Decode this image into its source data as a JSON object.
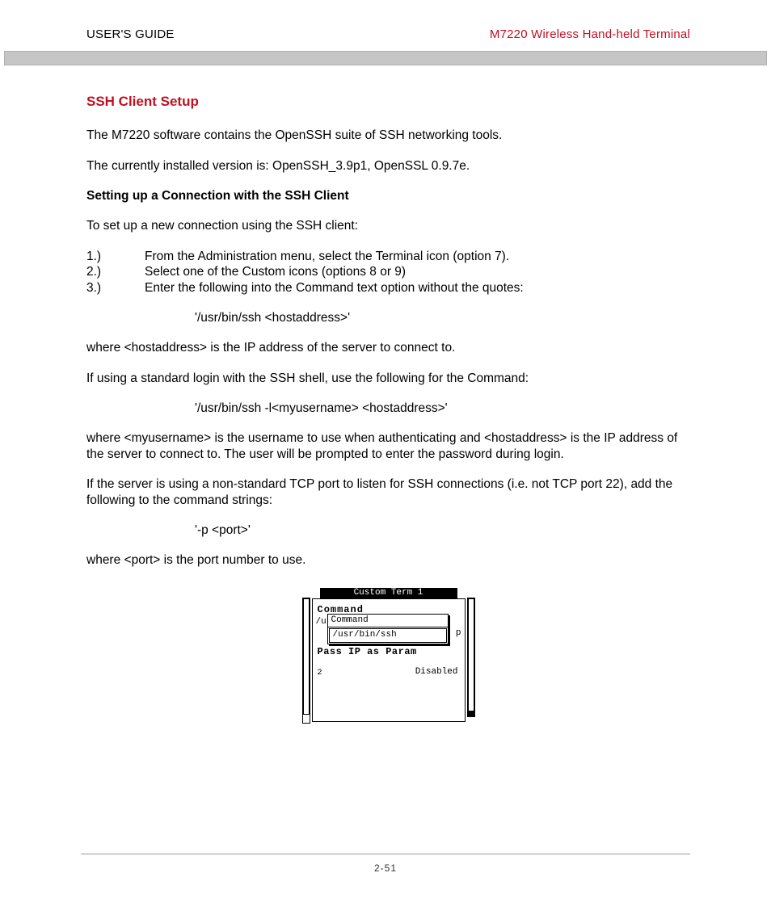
{
  "header": {
    "left": "USER'S GUIDE",
    "right": "M7220 Wireless Hand-held Terminal"
  },
  "title": "SSH Client Setup",
  "p1": "The M7220 software contains the OpenSSH suite of SSH networking tools.",
  "p2": "The currently installed version is: OpenSSH_3.9p1, OpenSSL 0.9.7e.",
  "sub1": "Setting up a Connection with the SSH Client",
  "p3": "To set up a new connection using the SSH client:",
  "steps": {
    "n1": "1.)",
    "t1": "From the Administration menu, select the Terminal icon (option 7).",
    "n2": "2.)",
    "t2": "Select one of the Custom icons (options 8 or 9)",
    "n3": "3.)",
    "t3": "Enter the following into the Command text option without the quotes:"
  },
  "cmd1": "'/usr/bin/ssh <hostaddress>'",
  "p4": "where <hostaddress> is the IP address of the server to connect to.",
  "p5": "If using a standard login with the SSH shell, use the following for the Command:",
  "cmd2": "'/usr/bin/ssh -l<myusername> <hostaddress>'",
  "p6": "where <myusername> is the username to use when authenticating and <hostaddress> is the IP address of the server to connect to.  The user will be prompted to enter the password during login.",
  "p7": "If the server is using a non-standard TCP port to listen for SSH connections (i.e. not TCP port 22), add the following to the command strings:",
  "cmd3": "'-p <port>'",
  "p8": "where <port> is the port number to use.",
  "device": {
    "title": "Custom Term 1",
    "label_command": "Command",
    "edge_left": "/u",
    "edge_right": "p",
    "popup_label": "Command",
    "popup_value": "/usr/bin/ssh",
    "pass_label": "Pass IP as Param",
    "num": "2",
    "disabled": "Disabled"
  },
  "page_number": "2-51"
}
